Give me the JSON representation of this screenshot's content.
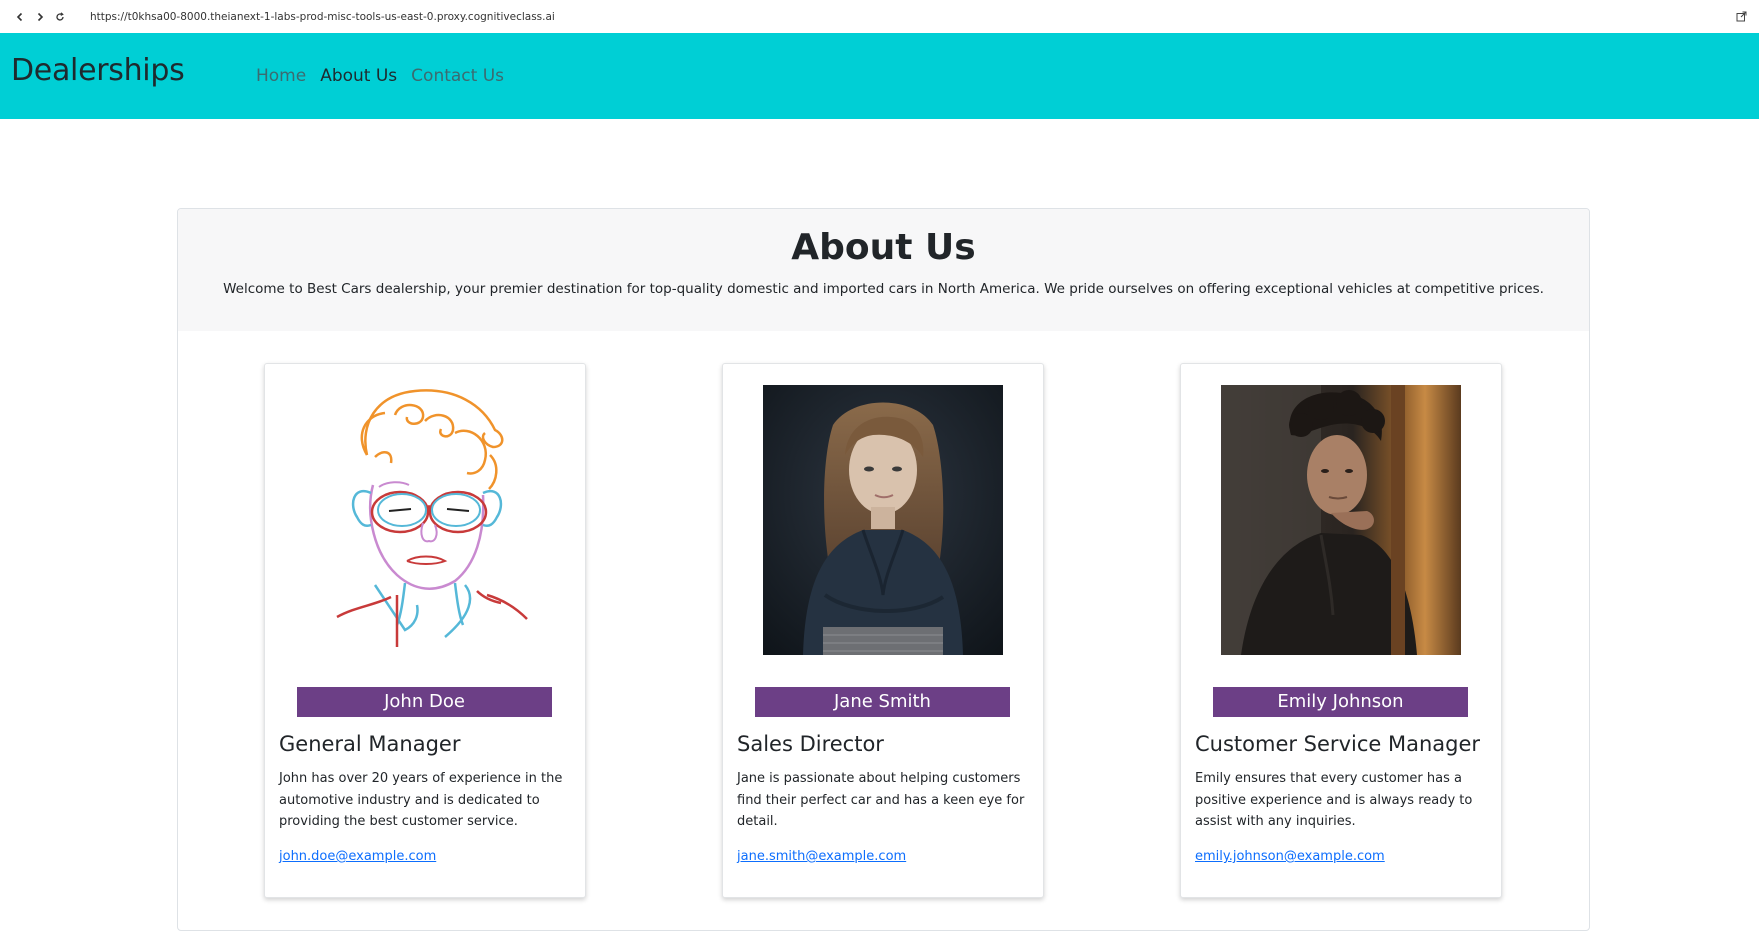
{
  "browser": {
    "url": "https://t0khsa00-8000.theianext-1-labs-prod-misc-tools-us-east-0.proxy.cognitiveclass.ai",
    "icons": [
      "back-icon",
      "forward-icon",
      "reload-icon",
      "external-link-icon"
    ]
  },
  "navbar": {
    "brand": "Dealerships",
    "links": {
      "home": "Home",
      "about": "About Us",
      "contact": "Contact Us"
    },
    "colors": {
      "background": "#00cfd5",
      "active": "#1e2a2e",
      "inactive": "#3b6b70"
    }
  },
  "about": {
    "title": "About Us",
    "description": "Welcome to Best Cars dealership, your premier destination for top-quality domestic and imported cars in North America. We pride ourselves on offering exceptional vehicles at competitive prices."
  },
  "team": [
    {
      "name": "John Doe",
      "role": "General Manager",
      "bio": "John has over 20 years of experience in the automotive industry and is dedicated to providing the best customer service.",
      "email": "john.doe@example.com",
      "photo": "line-drawing-portrait"
    },
    {
      "name": "Jane Smith",
      "role": "Sales Director",
      "bio": "Jane is passionate about helping customers find their perfect car and has a keen eye for detail.",
      "email": "jane.smith@example.com",
      "photo": "portrait-photo-woman"
    },
    {
      "name": "Emily Johnson",
      "role": "Customer Service Manager",
      "bio": "Emily ensures that every customer has a positive experience and is always ready to assist with any inquiries.",
      "email": "emily.johnson@example.com",
      "photo": "portrait-photo-doorway"
    }
  ],
  "colors": {
    "nameplate": "#6c3f86",
    "link": "#0d6efd"
  }
}
